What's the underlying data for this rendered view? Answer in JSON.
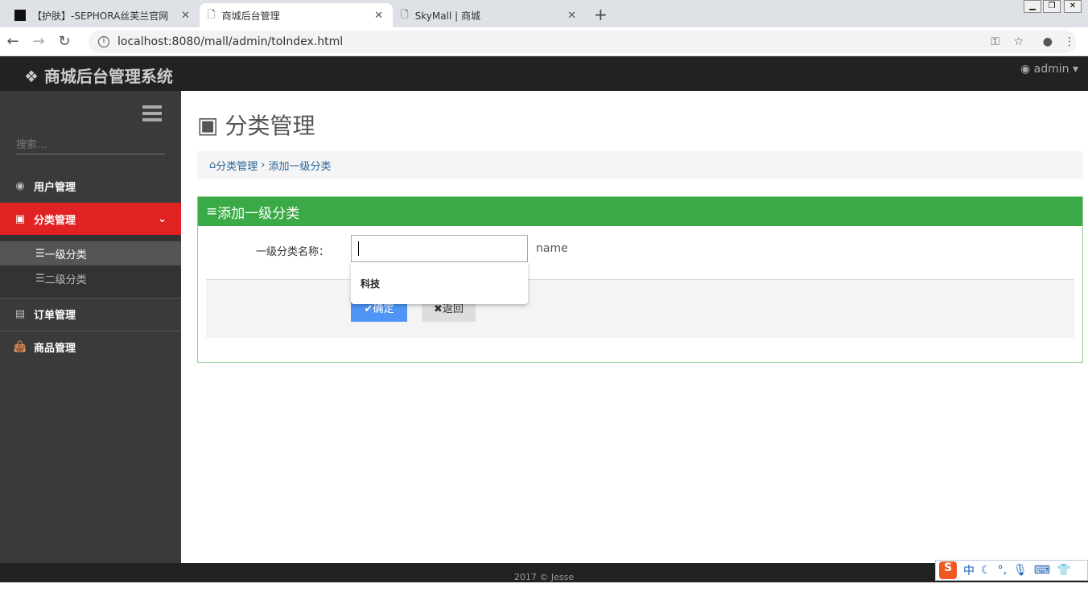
{
  "browser": {
    "tabs": [
      {
        "label": "【护肤】-SEPHORA丝芙兰官网"
      },
      {
        "label": "商城后台管理"
      },
      {
        "label": "SkyMall | 商城"
      }
    ],
    "url": "localhost:8080/mall/admin/toIndex.html"
  },
  "header": {
    "brand": "商城后台管理系统",
    "user": "admin"
  },
  "sidebar": {
    "search_placeholder": "搜索...",
    "items": [
      {
        "label": "用户管理"
      },
      {
        "label": "分类管理"
      },
      {
        "label": "一级分类"
      },
      {
        "label": "二级分类"
      },
      {
        "label": "订单管理"
      },
      {
        "label": "商品管理"
      }
    ]
  },
  "main": {
    "title": "分类管理",
    "breadcrumb": [
      "分类管理",
      "添加一级分类"
    ],
    "panel_title": "添加一级分类",
    "field_label": "一级分类名称：",
    "field_value": "",
    "field_hint": "name",
    "autocomplete": "科技",
    "ok": "确定",
    "back": "返回"
  },
  "footer": {
    "text": "2017 © Jesse"
  },
  "ime": {
    "lang": "中"
  }
}
